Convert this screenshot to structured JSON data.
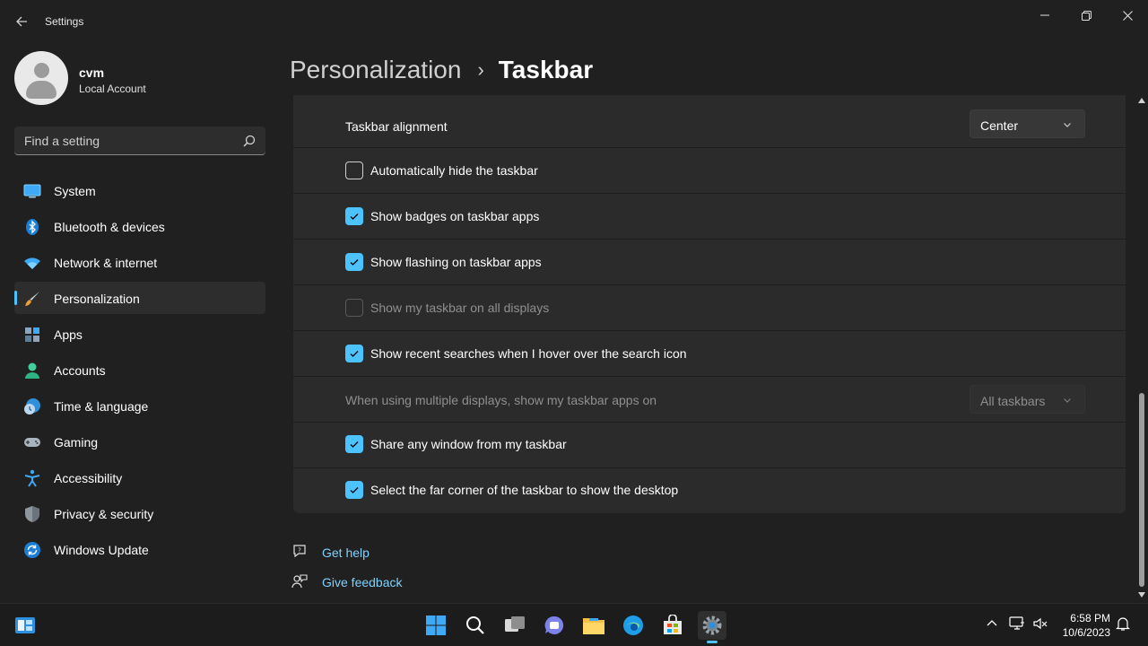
{
  "window": {
    "title": "Settings"
  },
  "profile": {
    "name": "cvm",
    "account_type": "Local Account"
  },
  "search": {
    "placeholder": "Find a setting"
  },
  "sidebar": {
    "items": [
      {
        "label": "System",
        "icon": "system-icon"
      },
      {
        "label": "Bluetooth & devices",
        "icon": "bluetooth-icon"
      },
      {
        "label": "Network & internet",
        "icon": "wifi-icon"
      },
      {
        "label": "Personalization",
        "icon": "brush-icon",
        "active": true
      },
      {
        "label": "Apps",
        "icon": "apps-icon"
      },
      {
        "label": "Accounts",
        "icon": "accounts-icon"
      },
      {
        "label": "Time & language",
        "icon": "time-language-icon"
      },
      {
        "label": "Gaming",
        "icon": "gamepad-icon"
      },
      {
        "label": "Accessibility",
        "icon": "accessibility-icon"
      },
      {
        "label": "Privacy & security",
        "icon": "shield-icon"
      },
      {
        "label": "Windows Update",
        "icon": "update-icon"
      }
    ]
  },
  "breadcrumb": {
    "parent": "Personalization",
    "separator": "›",
    "current": "Taskbar"
  },
  "settings": {
    "alignment": {
      "label": "Taskbar alignment",
      "value": "Center"
    },
    "auto_hide": {
      "label": "Automatically hide the taskbar",
      "checked": false
    },
    "badges": {
      "label": "Show badges on taskbar apps",
      "checked": true
    },
    "flashing": {
      "label": "Show flashing on taskbar apps",
      "checked": true
    },
    "all_displays": {
      "label": "Show my taskbar on all displays",
      "checked": false,
      "disabled": true
    },
    "recent_searches": {
      "label": "Show recent searches when I hover over the search icon",
      "checked": true
    },
    "multi_display": {
      "label": "When using multiple displays, show my taskbar apps on",
      "value": "All taskbars",
      "disabled": true
    },
    "share_window": {
      "label": "Share any window from my taskbar",
      "checked": true
    },
    "far_corner": {
      "label": "Select the far corner of the taskbar to show the desktop",
      "checked": true
    }
  },
  "help": {
    "get_help": "Get help",
    "give_feedback": "Give feedback"
  },
  "taskbar": {
    "apps": [
      "start-icon",
      "search-icon",
      "task-view-icon",
      "teams-chat-icon",
      "file-explorer-icon",
      "edge-icon",
      "store-icon",
      "settings-icon"
    ],
    "clock_time": "6:58 PM",
    "clock_date": "10/6/2023"
  },
  "colors": {
    "accent": "#4cc2ff",
    "background": "#202020",
    "card": "#2b2b2b",
    "link": "#7fd1ff"
  }
}
